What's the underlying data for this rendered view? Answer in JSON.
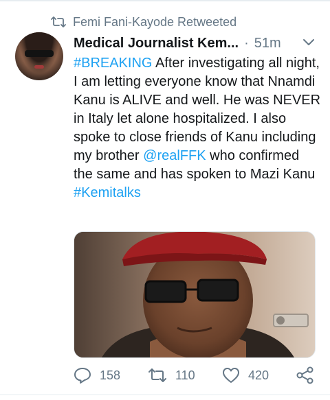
{
  "retweet_header": {
    "text": "Femi Fani-Kayode Retweeted",
    "icon": "retweet-icon"
  },
  "tweet": {
    "author_name": "Medical Journalist Kem...",
    "separator": "·",
    "time": "51m",
    "menu_icon": "chevron-down-icon",
    "text_parts": {
      "hashtag_breaking": "#BREAKING",
      "body_1": " After investigating all night, I am letting everyone know that Nnamdi Kanu is ALIVE and well. He was NEVER in Italy let alone hospitalized. I also spoke to close friends of Kanu including my brother ",
      "mention": "@realFFK",
      "body_2": " who confirmed the same and has spoken to Mazi Kanu ",
      "hashtag_kemitalks": "#Kemitalks"
    },
    "media": {
      "description_icon": "photo-man-red-beret"
    }
  },
  "actions": {
    "reply": {
      "icon": "reply-icon",
      "count": "158"
    },
    "retweet": {
      "icon": "retweet-icon",
      "count": "110"
    },
    "like": {
      "icon": "heart-icon",
      "count": "420"
    },
    "share": {
      "icon": "share-icon"
    }
  },
  "colors": {
    "link": "#1da1f2",
    "secondary_text": "#657786",
    "primary_text": "#14171a",
    "beret": "#a21f22"
  }
}
